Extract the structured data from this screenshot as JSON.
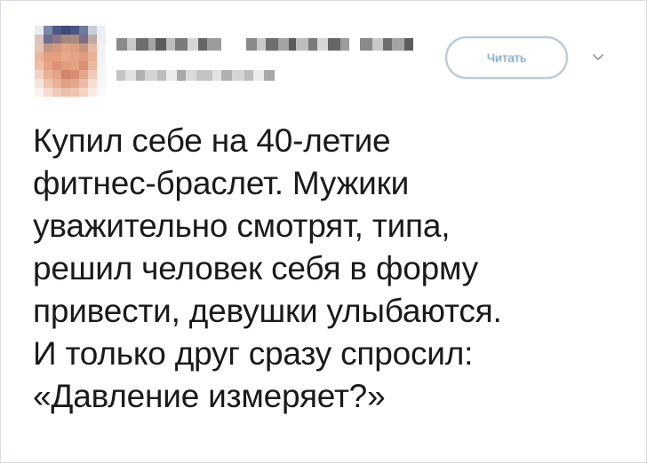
{
  "header": {
    "follow_label": "Читать",
    "menu_icon": "chevron-down-icon",
    "avatar_icon": "blurred-avatar"
  },
  "colors": {
    "follow_border": "#aebfcc",
    "follow_text": "#5f8fb4",
    "text": "#1a1a1a",
    "card_border": "#d9dde1"
  },
  "tweet": {
    "lines": [
      "Купил себе на 40-летие",
      "фитнес-браслет. Мужики",
      "уважительно смотрят, типа,",
      "решил человек себя в форму",
      "привести, девушки улыбаются.",
      "И только друг сразу спросил:",
      "«Давление измеряет?»"
    ]
  }
}
